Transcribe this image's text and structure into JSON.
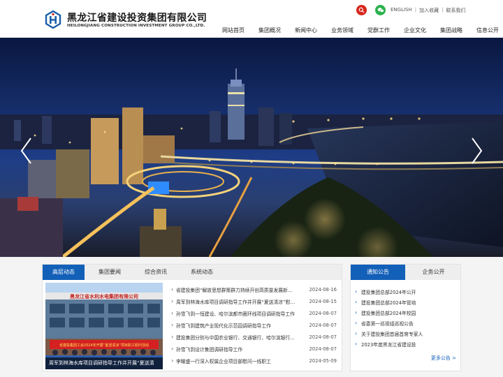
{
  "header": {
    "company_cn": "黑龙江省建设投资集团有限公司",
    "company_en": "HEILONGJIANG CONSTRUCTION INVESTMENT GROUP CO.,LTD.",
    "top_links": [
      "ENGLISH",
      "加入收藏",
      "联系我们"
    ],
    "top_icons": [
      "search-icon",
      "wechat-icon"
    ]
  },
  "nav": {
    "items": [
      "网站首页",
      "集团概况",
      "新闻中心",
      "业务领域",
      "党群工作",
      "企业文化",
      "集团战略",
      "信息公开"
    ]
  },
  "news": {
    "tabs": [
      "高层动态",
      "集团要闻",
      "综合资讯",
      "系统动态"
    ],
    "active_tab": "高层动态",
    "image_caption": "周军到林海水库项目调研指导工作并开展“夏送清",
    "image_texts": {
      "sign": "黑龙江省水利水电集团有限公司",
      "banner": "省建投集团工会2024年开展“夏送清凉”项目职工慰问活动"
    },
    "items": [
      {
        "title": "省建投集团“解放思想群策群力持续开创高质量发展新…",
        "date": "2024-08-16"
      },
      {
        "title": "周军到林海水库项目调研指导工作并开展“夏送清凉”慰…",
        "date": "2024-08-15"
      },
      {
        "title": "孙雪飞到一恒建设、哈尔滨都市圈环线项目调研指导工作",
        "date": "2024-08-07"
      },
      {
        "title": "孙雪飞到建筑产业现代化示范园调研指导工作",
        "date": "2024-08-07"
      },
      {
        "title": "建投集团分别与中国农业银行、交通银行、哈尔滨银行…",
        "date": "2024-08-07"
      },
      {
        "title": "孙雪飞到设计集团调研指导工作",
        "date": "2024-08-07"
      },
      {
        "title": "李曜盛一行深入权属企业项目部慰问一线职工",
        "date": "2024-05-09"
      }
    ]
  },
  "notice": {
    "tabs": [
      "通知公告",
      "企务公开"
    ],
    "active_tab": "通知公告",
    "items": [
      "建投集团总部2024年公开",
      "建投集团总部2024年管培",
      "建投集团总部2024年校园",
      "省委第一巡视组巡视公告",
      "关于建投集团首届首席专家人",
      "2023年度黑龙江省建设投"
    ],
    "more_label": "更多公告 >"
  },
  "colors": {
    "primary_blue": "#1360b8",
    "search_red": "#d8261c",
    "wechat_green": "#2ab24c"
  }
}
